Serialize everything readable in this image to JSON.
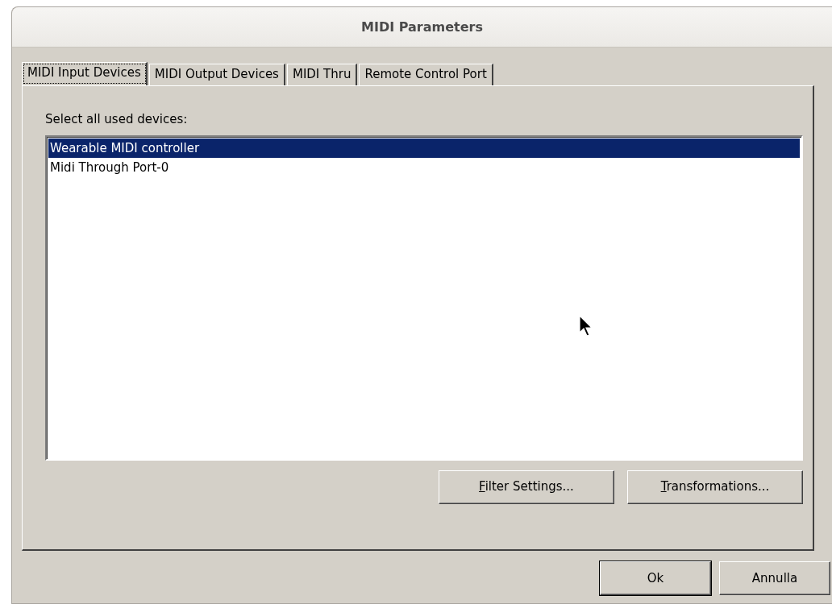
{
  "window": {
    "title": "MIDI Parameters"
  },
  "tabs": [
    {
      "label": "MIDI Input Devices",
      "selected": true
    },
    {
      "label": "MIDI Output Devices",
      "selected": false
    },
    {
      "label": "MIDI Thru",
      "selected": false
    },
    {
      "label": "Remote Control Port",
      "selected": false
    }
  ],
  "panel": {
    "label": "Select all used devices:",
    "devices": [
      {
        "name": "Wearable MIDI controller",
        "selected": true
      },
      {
        "name": "Midi Through Port-0",
        "selected": false
      }
    ],
    "buttons": [
      {
        "label": "Filter Settings...",
        "underline_first": true
      },
      {
        "label": "Transformations...",
        "underline_first": true
      }
    ]
  },
  "dialog_buttons": [
    {
      "label": "Ok",
      "default": true
    },
    {
      "label": "Annulla",
      "default": false
    }
  ]
}
